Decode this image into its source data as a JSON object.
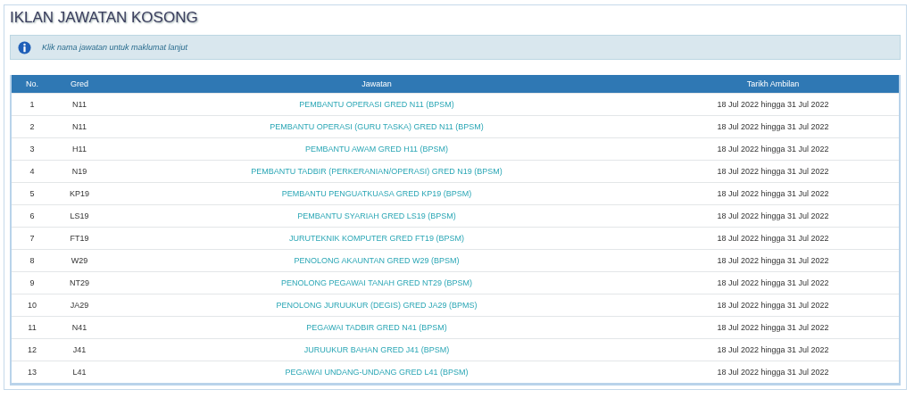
{
  "title": "IKLAN JAWATAN KOSONG",
  "info": "Klik nama jawatan untuk maklumat lanjut",
  "table": {
    "columns": [
      "No.",
      "Gred",
      "Jawatan",
      "Tarikh Ambilan"
    ],
    "rows": [
      [
        "1",
        "N11",
        "PEMBANTU OPERASI GRED N11 (BPSM)",
        "18 Jul 2022 hingga 31 Jul 2022"
      ],
      [
        "2",
        "N11",
        "PEMBANTU OPERASI (GURU TASKA) GRED N11 (BPSM)",
        "18 Jul 2022 hingga 31 Jul 2022"
      ],
      [
        "3",
        "H11",
        "PEMBANTU AWAM GRED H11 (BPSM)",
        "18 Jul 2022 hingga 31 Jul 2022"
      ],
      [
        "4",
        "N19",
        "PEMBANTU TADBIR (PERKERANIAN/OPERASI) GRED N19 (BPSM)",
        "18 Jul 2022 hingga 31 Jul 2022"
      ],
      [
        "5",
        "KP19",
        "PEMBANTU PENGUATKUASA GRED KP19 (BPSM)",
        "18 Jul 2022 hingga 31 Jul 2022"
      ],
      [
        "6",
        "LS19",
        "PEMBANTU SYARIAH GRED LS19 (BPSM)",
        "18 Jul 2022 hingga 31 Jul 2022"
      ],
      [
        "7",
        "FT19",
        "JURUTEKNIK KOMPUTER GRED FT19 (BPSM)",
        "18 Jul 2022 hingga 31 Jul 2022"
      ],
      [
        "8",
        "W29",
        "PENOLONG AKAUNTAN GRED W29 (BPSM)",
        "18 Jul 2022 hingga 31 Jul 2022"
      ],
      [
        "9",
        "NT29",
        "PENOLONG PEGAWAI TANAH GRED NT29 (BPSM)",
        "18 Jul 2022 hingga 31 Jul 2022"
      ],
      [
        "10",
        "JA29",
        "PENOLONG JURUUKUR (DEGIS) GRED JA29 (BPMS)",
        "18 Jul 2022 hingga 31 Jul 2022"
      ],
      [
        "11",
        "N41",
        "PEGAWAI TADBIR GRED N41 (BPSM)",
        "18 Jul 2022 hingga 31 Jul 2022"
      ],
      [
        "12",
        "J41",
        "JURUUKUR BAHAN GRED J41 (BPSM)",
        "18 Jul 2022 hingga 31 Jul 2022"
      ],
      [
        "13",
        "L41",
        "PEGAWAI UNDANG-UNDANG GRED L41 (BPSM)",
        "18 Jul 2022 hingga 31 Jul 2022"
      ]
    ]
  }
}
